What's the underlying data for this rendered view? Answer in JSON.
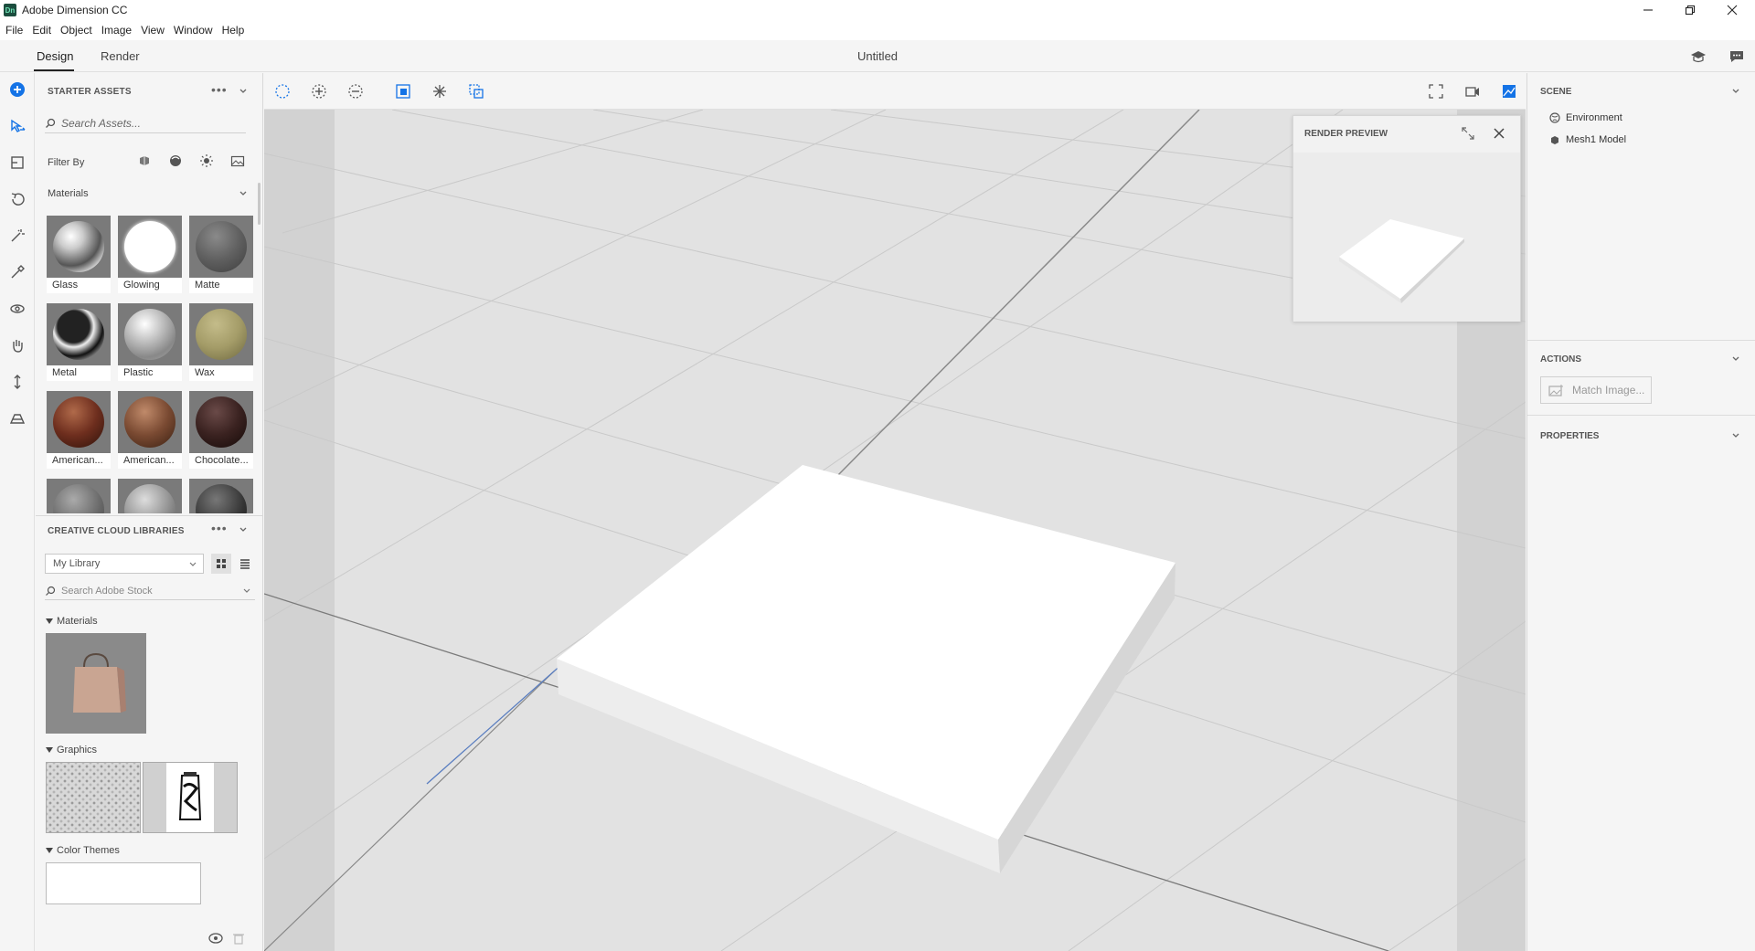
{
  "window": {
    "title": "Adobe Dimension CC",
    "icon_text": "Dn"
  },
  "menu": [
    "File",
    "Edit",
    "Object",
    "Image",
    "View",
    "Window",
    "Help"
  ],
  "modes": {
    "design": "Design",
    "render": "Render"
  },
  "document": {
    "title": "Untitled"
  },
  "starter_assets": {
    "header": "STARTER ASSETS",
    "search_placeholder": "Search Assets...",
    "filter_label": "Filter By",
    "materials_label": "Materials",
    "materials": [
      {
        "label": "Glass",
        "color": "#b8b8b8"
      },
      {
        "label": "Glowing",
        "color": "#ffffff"
      },
      {
        "label": "Matte",
        "color": "#6e6e6e"
      },
      {
        "label": "Metal",
        "color": "#3a3a3a"
      },
      {
        "label": "Plastic",
        "color": "#bdbdbd"
      },
      {
        "label": "Wax",
        "color": "#a8a070"
      },
      {
        "label": "American...",
        "color": "#6e2e1e"
      },
      {
        "label": "American...",
        "color": "#7a4a32"
      },
      {
        "label": "Chocolate...",
        "color": "#3a2220"
      }
    ]
  },
  "cc_libraries": {
    "header": "CREATIVE CLOUD LIBRARIES",
    "library_select": "My Library",
    "stock_search_placeholder": "Search Adobe Stock",
    "sections": {
      "materials": "Materials",
      "graphics": "Graphics",
      "color_themes": "Color Themes"
    }
  },
  "render_preview": {
    "title": "RENDER PREVIEW"
  },
  "scene_panel": {
    "header": "SCENE",
    "items": [
      "Environment",
      "Mesh1 Model"
    ]
  },
  "actions_panel": {
    "header": "ACTIONS",
    "match_image": "Match Image..."
  },
  "properties_panel": {
    "header": "PROPERTIES"
  }
}
